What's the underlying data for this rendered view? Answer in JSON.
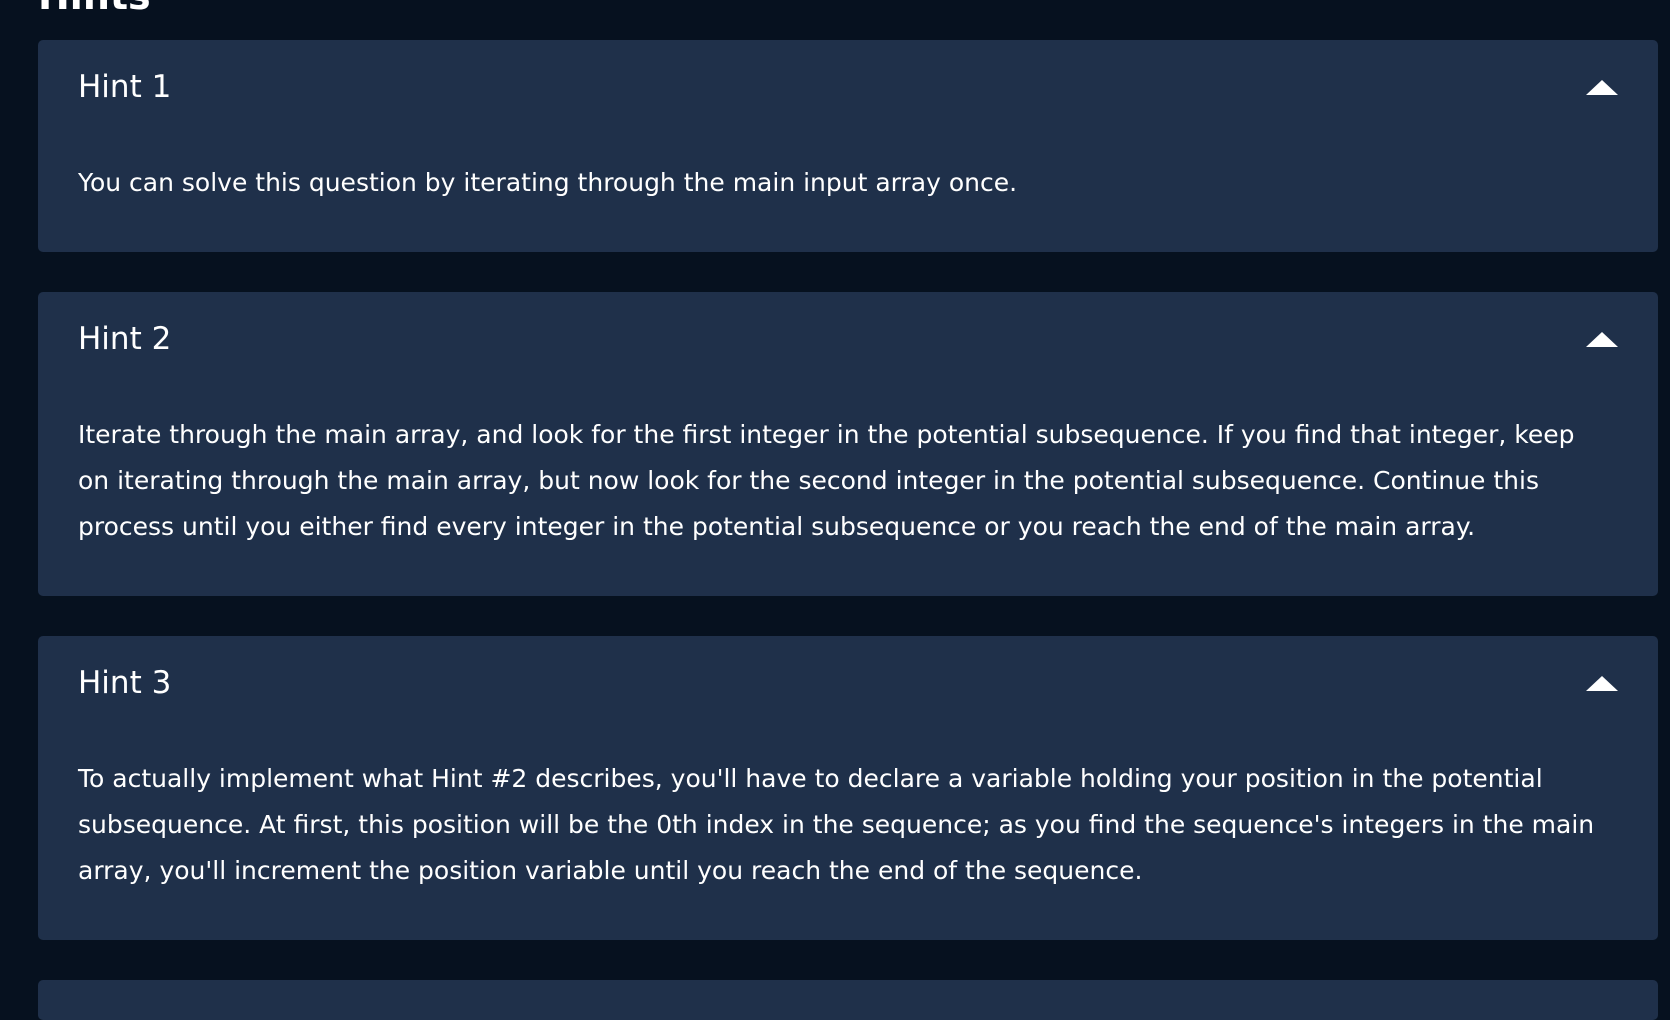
{
  "section": {
    "heading": "Hints"
  },
  "hints": [
    {
      "title": "Hint 1",
      "toggle_icon": "chevron-up-icon",
      "body": "You can solve this question by iterating through the main input array once."
    },
    {
      "title": "Hint 2",
      "toggle_icon": "chevron-up-icon",
      "body": "Iterate through the main array, and look for the first integer in the potential subsequence. If you find that integer, keep on iterating through the main array, but now look for the second integer in the potential subsequence. Continue this process until you either find every integer in the potential subsequence or you reach the end of the main array."
    },
    {
      "title": "Hint 3",
      "toggle_icon": "chevron-up-icon",
      "body": "To actually implement what Hint #2 describes, you'll have to declare a variable holding your position in the potential subsequence. At first, this position will be the 0th index in the sequence; as you find the sequence's integers in the main array, you'll increment the position variable until you reach the end of the sequence."
    }
  ],
  "colors": {
    "page_background": "#06111f",
    "card_background": "#1f304a",
    "text": "#ffffff"
  }
}
